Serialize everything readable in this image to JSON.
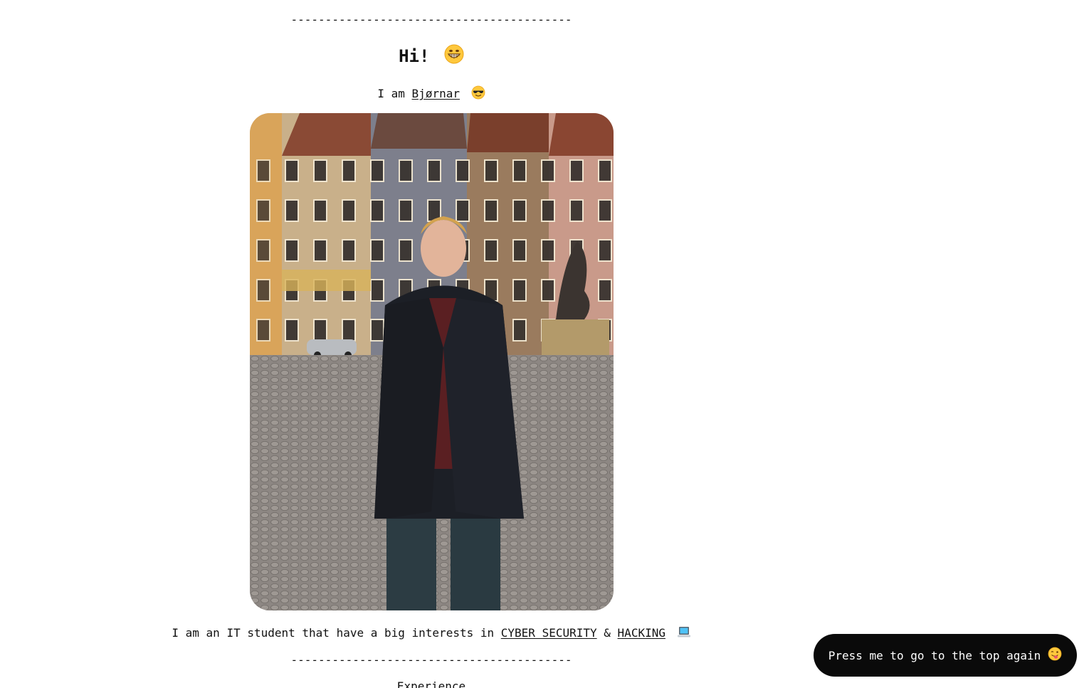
{
  "divider_text": "-----------------------------------------",
  "hero": {
    "greeting": "Hi!",
    "intro_prefix": "I am",
    "name_link": "Bjørnar",
    "greeting_icon": "grinning-face-icon",
    "intro_icon": "sunglasses-face-icon"
  },
  "photo": {
    "alt": "Photo of Bjørnar in a town square"
  },
  "interests": {
    "prefix": "I am an IT student that have a big interests in",
    "link1": "CYBER SECURITY",
    "amp": "&",
    "link2": "HACKING",
    "icon": "laptop-icon"
  },
  "next_section": {
    "title": "Experience"
  },
  "scroll_top_button": {
    "label": "Press me to go to the top again",
    "icon": "tongue-wink-face-icon"
  },
  "colors": {
    "background": "#ffffff",
    "text": "#111111",
    "button_bg": "#0a0a0a",
    "button_text": "#ffffff"
  }
}
